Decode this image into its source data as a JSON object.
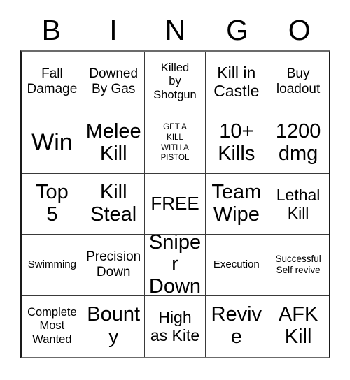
{
  "card": {
    "title": "BINGO",
    "background_color": "#ffffff",
    "text_color": "#000000",
    "border_color": "#3a3a3a",
    "columns": 5,
    "rows": 5,
    "free_space": "FREE"
  },
  "header": {
    "letters": [
      {
        "label": "B"
      },
      {
        "label": "I"
      },
      {
        "label": "N"
      },
      {
        "label": "G"
      },
      {
        "label": "O"
      }
    ]
  },
  "grid": {
    "cells": [
      {
        "text": "Fall\nDamage",
        "size": "fs-md2"
      },
      {
        "text": "Downed\nBy Gas",
        "size": "fs-md2"
      },
      {
        "text": "Killed\nby\nShotgun",
        "size": "fs-md"
      },
      {
        "text": "Kill in\nCastle",
        "size": "fs-lg"
      },
      {
        "text": "Buy\nloadout",
        "size": "fs-md2"
      },
      {
        "text": "Win",
        "size": "fs-huge"
      },
      {
        "text": "Melee\nKill",
        "size": "fs-xxl"
      },
      {
        "text": "GET A\nKILL\nWITH A\nPISTOL",
        "size": "fs-xs"
      },
      {
        "text": "10+\nKills",
        "size": "fs-xxl"
      },
      {
        "text": "1200\ndmg",
        "size": "fs-xxl"
      },
      {
        "text": "Top\n5",
        "size": "fs-xxl"
      },
      {
        "text": "Kill\nSteal",
        "size": "fs-xxl"
      },
      {
        "text": "FREE",
        "size": "fs-xl"
      },
      {
        "text": "Team\nWipe",
        "size": "fs-xxl"
      },
      {
        "text": "Lethal\nKill",
        "size": "fs-lg"
      },
      {
        "text": "Swimming",
        "size": "fs-sm2"
      },
      {
        "text": "Precision\nDown",
        "size": "fs-md2"
      },
      {
        "text": "Sniper\nDown",
        "size": "fs-xxl"
      },
      {
        "text": "Execution",
        "size": "fs-sm2"
      },
      {
        "text": "Successful\nSelf revive",
        "size": "fs-sm"
      },
      {
        "text": "Complete\nMost\nWanted",
        "size": "fs-md"
      },
      {
        "text": "Bounty",
        "size": "fs-xxl"
      },
      {
        "text": "High\nas Kite",
        "size": "fs-lg"
      },
      {
        "text": "Revive",
        "size": "fs-xxl"
      },
      {
        "text": "AFK\nKill",
        "size": "fs-xxl"
      }
    ]
  }
}
